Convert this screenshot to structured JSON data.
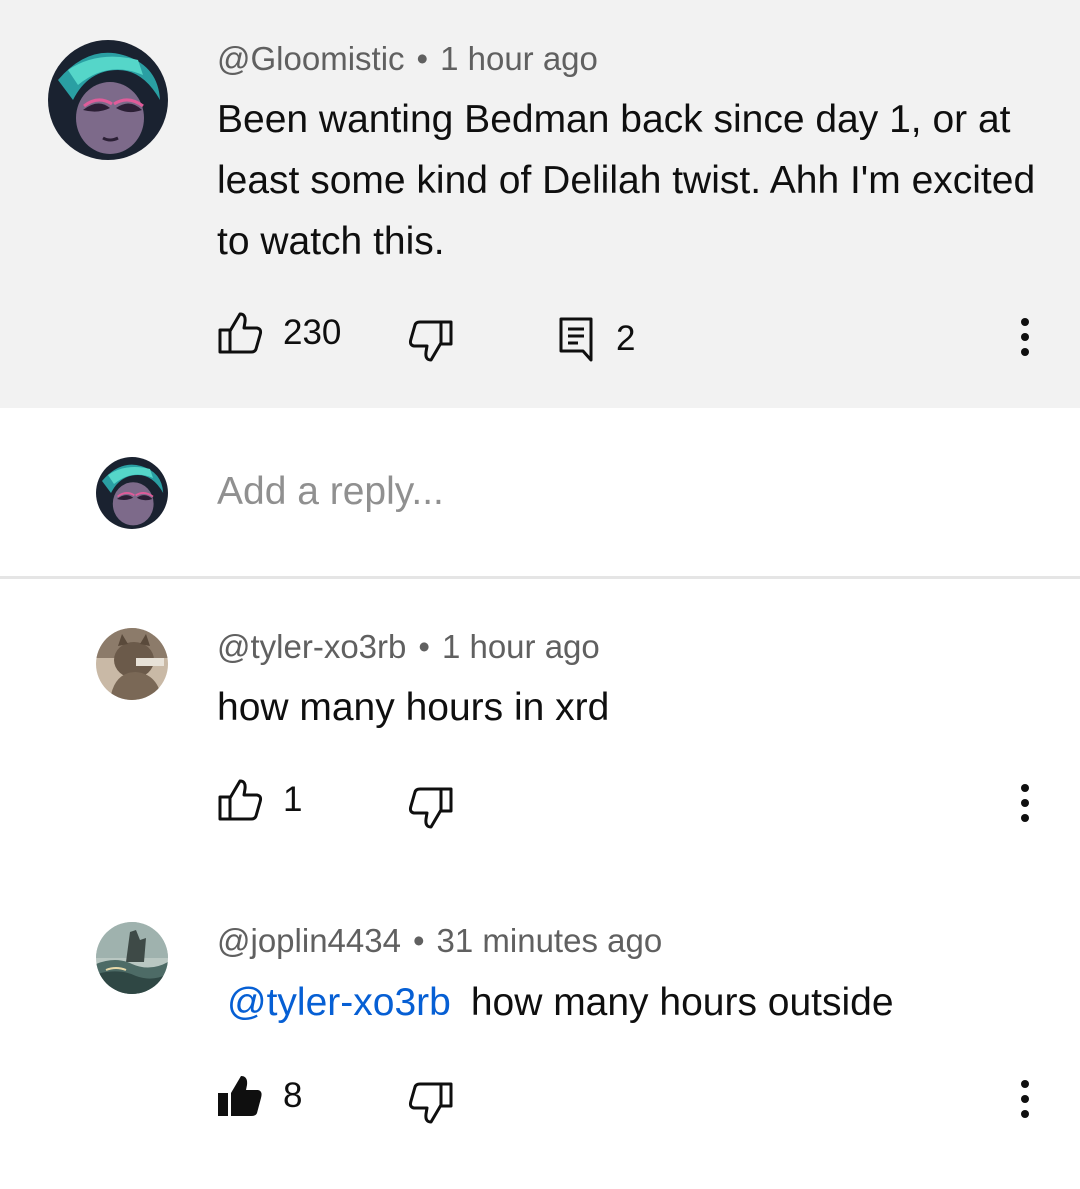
{
  "comments": [
    {
      "username": "@Gloomistic",
      "time": "1 hour ago",
      "text": "Been wanting Bedman back since day 1, or at least some kind of Delilah twist. Ahh I'm excited to watch this.",
      "likes": "230",
      "replies": "2",
      "liked": false
    },
    {
      "username": "@tyler-xo3rb",
      "time": "1 hour ago",
      "text": "how many hours in xrd",
      "likes": "1",
      "liked": false
    },
    {
      "username": "@joplin4434",
      "time": "31 minutes ago",
      "mention": "@tyler-xo3rb",
      "text": "how many hours outside",
      "likes": "8",
      "liked": true
    }
  ],
  "reply_box": {
    "placeholder": "Add a reply..."
  },
  "separator": "•",
  "colors": {
    "highlight_bg": "#f2f2f2",
    "mention": "#065fd4",
    "meta_text": "#606060"
  },
  "icons": {
    "like": "thumb-up-outline-icon",
    "like_filled": "thumb-up-filled-icon",
    "dislike": "thumb-down-outline-icon",
    "reply": "comment-icon",
    "more": "more-vert-icon"
  }
}
